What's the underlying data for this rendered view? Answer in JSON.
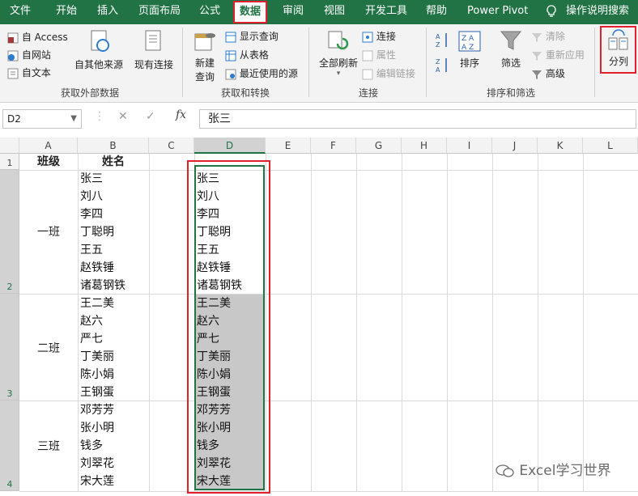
{
  "menu": [
    "文件",
    "开始",
    "插入",
    "页面布局",
    "公式",
    "数据",
    "审阅",
    "视图",
    "开发工具",
    "帮助",
    "Power Pivot",
    "操作说明搜索"
  ],
  "ribbon": {
    "get_external": {
      "access": "自 Access",
      "web": "自网站",
      "text": "自文本",
      "other": "自其他来源",
      "existing": "现有连接",
      "group": "获取外部数据"
    },
    "get_transform": {
      "new_query": "新建",
      "new_query2": "查询",
      "show_queries": "显示查询",
      "from_table": "从表格",
      "recent_sources": "最近使用的源",
      "group": "获取和转换"
    },
    "connections": {
      "refresh_all": "全部刷新",
      "connections": "连接",
      "properties": "属性",
      "edit_links": "编辑链接",
      "group": "连接"
    },
    "sort_filter": {
      "sort": "排序",
      "filter": "筛选",
      "clear": "清除",
      "reapply": "重新应用",
      "advanced": "高级",
      "group": "排序和筛选"
    },
    "data_tools": {
      "text_to_columns": "分列"
    }
  },
  "formula_bar": {
    "name_box": "D2",
    "fx": "fx",
    "value": "张三"
  },
  "columns": [
    "A",
    "B",
    "C",
    "D",
    "E",
    "F",
    "G",
    "H",
    "I",
    "J",
    "K",
    "L"
  ],
  "rows": [
    "1",
    "2",
    "3",
    "4"
  ],
  "headers": {
    "class": "班级",
    "name": "姓名"
  },
  "classes": [
    "一班",
    "二班",
    "三班"
  ],
  "names_b": [
    "张三",
    "刘八",
    "李四",
    "丁聪明",
    "王五",
    "赵铁锤",
    "诸葛钢铁",
    "王二美",
    "赵六",
    "严七",
    "丁美丽",
    "陈小娟",
    "王钢蛋",
    "邓芳芳",
    "张小明",
    "钱多",
    "刘翠花",
    "宋大莲"
  ],
  "names_d": [
    "张三",
    "刘八",
    "李四",
    "丁聪明",
    "王五",
    "赵铁锤",
    "诸葛钢铁",
    "王二美",
    "赵六",
    "严七",
    "丁美丽",
    "陈小娟",
    "王钢蛋",
    "邓芳芳",
    "张小明",
    "钱多",
    "刘翠花",
    "宋大莲"
  ],
  "watermark": "Excel学习世界",
  "colors": {
    "excel_green": "#217346",
    "highlight_red": "#e0212d",
    "selection_gray": "#c8c8c8"
  }
}
